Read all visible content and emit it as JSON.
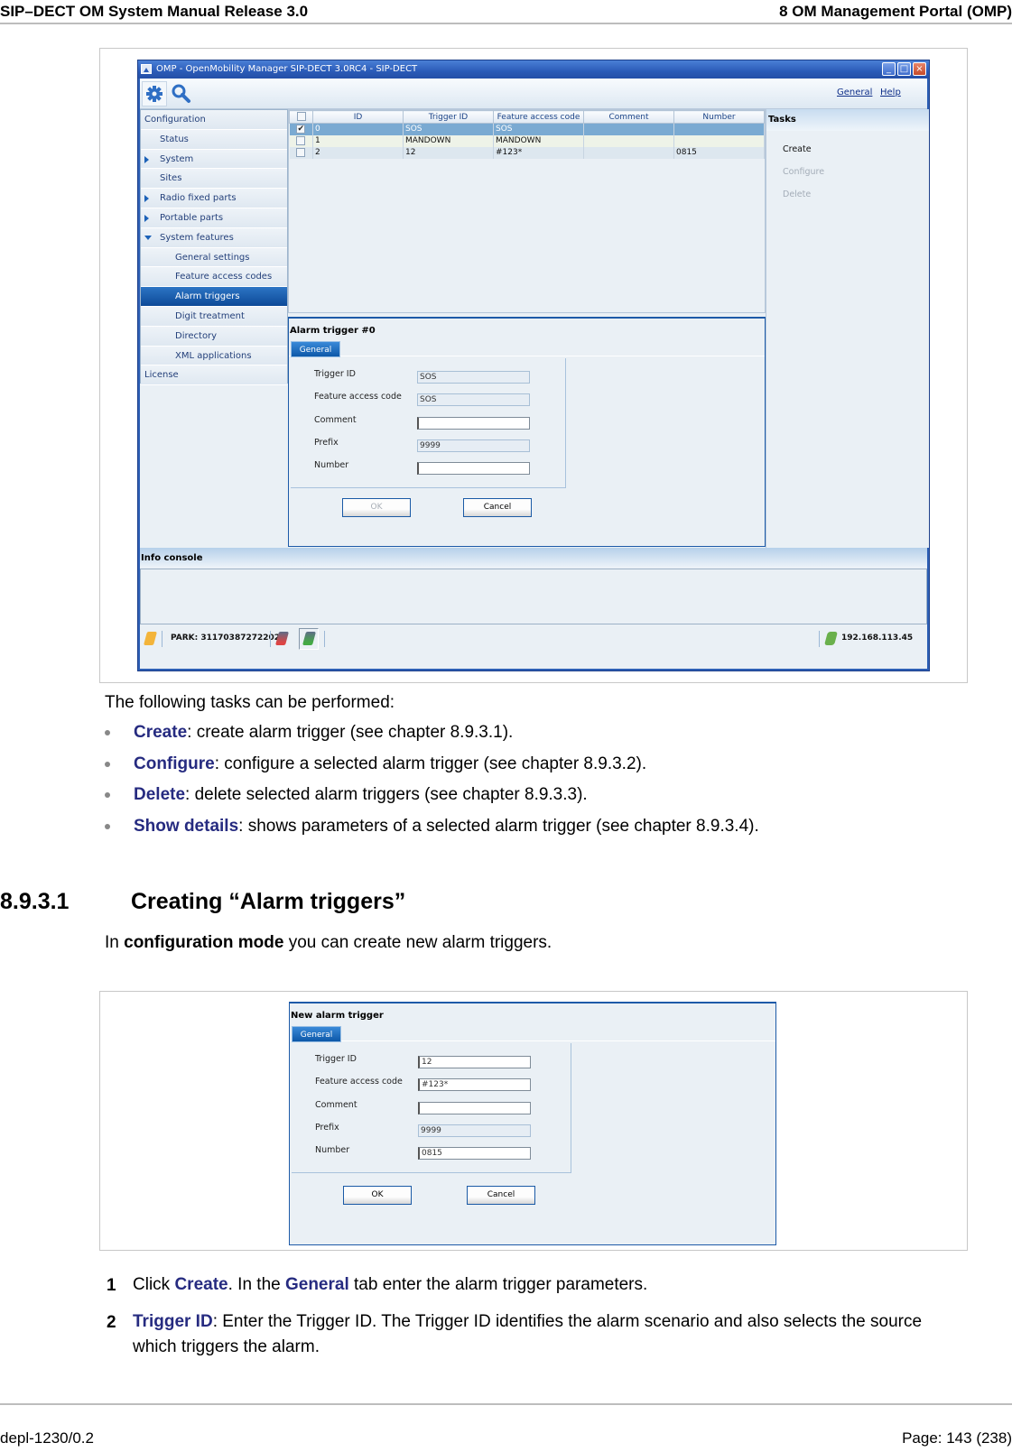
{
  "page": {
    "header_left": "SIP–DECT OM System Manual Release 3.0",
    "header_right": "8 OM Management Portal (OMP)",
    "footer_left": "depl-1230/0.2",
    "footer_right": "Page: 143 (238)"
  },
  "omp_window": {
    "title": "OMP - OpenMobility Manager SIP-DECT 3.0RC4 - SIP-DECT",
    "toolbar": {
      "icons": [
        "gear-icon",
        "search-icon"
      ],
      "links": [
        "General",
        "Help"
      ]
    },
    "sidebar": {
      "items": [
        {
          "label": "Configuration",
          "level": 0,
          "arrow": "none",
          "selected": false
        },
        {
          "label": "Status",
          "level": 1,
          "arrow": "none",
          "selected": false
        },
        {
          "label": "System",
          "level": 1,
          "arrow": "right",
          "selected": false
        },
        {
          "label": "Sites",
          "level": 1,
          "arrow": "none",
          "selected": false
        },
        {
          "label": "Radio fixed parts",
          "level": 1,
          "arrow": "right",
          "selected": false
        },
        {
          "label": "Portable parts",
          "level": 1,
          "arrow": "right",
          "selected": false
        },
        {
          "label": "System features",
          "level": 1,
          "arrow": "down",
          "selected": false
        },
        {
          "label": "General settings",
          "level": 2,
          "arrow": "none",
          "selected": false
        },
        {
          "label": "Feature access codes",
          "level": 2,
          "arrow": "none",
          "selected": false
        },
        {
          "label": "Alarm triggers",
          "level": 2,
          "arrow": "none",
          "selected": true
        },
        {
          "label": "Digit treatment",
          "level": 2,
          "arrow": "none",
          "selected": false
        },
        {
          "label": "Directory",
          "level": 2,
          "arrow": "none",
          "selected": false
        },
        {
          "label": "XML applications",
          "level": 2,
          "arrow": "none",
          "selected": false
        },
        {
          "label": "License",
          "level": 0,
          "arrow": "none",
          "selected": false
        }
      ]
    },
    "table": {
      "columns": [
        "ID",
        "Trigger ID",
        "Feature access code",
        "Comment",
        "Number"
      ],
      "rows": [
        {
          "checked": true,
          "cells": [
            "0",
            "SOS",
            "SOS",
            "",
            ""
          ]
        },
        {
          "checked": false,
          "cells": [
            "1",
            "MANDOWN",
            "MANDOWN",
            "",
            ""
          ]
        },
        {
          "checked": false,
          "cells": [
            "2",
            "12",
            "#123*",
            "",
            "0815"
          ]
        }
      ]
    },
    "tasks": {
      "title": "Tasks",
      "items": [
        {
          "label": "Create",
          "enabled": true
        },
        {
          "label": "Configure",
          "enabled": false
        },
        {
          "label": "Delete",
          "enabled": false
        }
      ]
    },
    "detail": {
      "title": "Alarm trigger #0",
      "tab": "General",
      "fields": [
        {
          "label": "Trigger ID",
          "value": "SOS",
          "editable": false
        },
        {
          "label": "Feature access code",
          "value": "SOS",
          "editable": false
        },
        {
          "label": "Comment",
          "value": "",
          "editable": true
        },
        {
          "label": "Prefix",
          "value": "9999",
          "editable": false
        },
        {
          "label": "Number",
          "value": "",
          "editable": true
        }
      ],
      "ok_label": "OK",
      "ok_enabled": false,
      "cancel_label": "Cancel"
    },
    "console": {
      "title": "Info console"
    },
    "statusbar": {
      "park": "PARK: 31170387272202",
      "ip": "192.168.113.45"
    }
  },
  "body": {
    "intro": "The following tasks can be performed:",
    "bullets": [
      {
        "keyword": "Create",
        "text": ": create alarm trigger (see chapter 8.9.3.1)."
      },
      {
        "keyword": "Configure",
        "text": ": configure a selected alarm trigger (see chapter 8.9.3.2)."
      },
      {
        "keyword": "Delete",
        "text": ": delete selected alarm triggers (see chapter 8.9.3.3)."
      },
      {
        "keyword": "Show details",
        "text": ": shows parameters of a selected alarm trigger (see chapter 8.9.3.4)."
      }
    ],
    "section": {
      "number": "8.9.3.1",
      "title": "Creating “Alarm triggers”"
    },
    "section_intro": {
      "pre": "In ",
      "bold": "configuration mode",
      "post": " you can create new alarm triggers."
    },
    "steps": [
      {
        "num": "1",
        "parts": [
          {
            "t": "Click ",
            "kw": false
          },
          {
            "t": "Create",
            "kw": true
          },
          {
            "t": ". In the ",
            "kw": false
          },
          {
            "t": "General",
            "kw": true
          },
          {
            "t": " tab enter the alarm trigger parameters.",
            "kw": false
          }
        ]
      },
      {
        "num": "2",
        "parts": [
          {
            "t": "Trigger ID",
            "kw": true
          },
          {
            "t": ": Enter the Trigger ID. The Trigger ID identifies the alarm scenario and also selects the source which triggers the alarm.",
            "kw": false
          }
        ]
      }
    ]
  },
  "new_dialog": {
    "title": "New alarm trigger",
    "tab": "General",
    "fields": [
      {
        "label": "Trigger ID",
        "value": "12",
        "editable": true
      },
      {
        "label": "Feature access code",
        "value": "#123*",
        "editable": true
      },
      {
        "label": "Comment",
        "value": "",
        "editable": true
      },
      {
        "label": "Prefix",
        "value": "9999",
        "editable": false
      },
      {
        "label": "Number",
        "value": "0815",
        "editable": true
      }
    ],
    "ok_label": "OK",
    "cancel_label": "Cancel"
  }
}
